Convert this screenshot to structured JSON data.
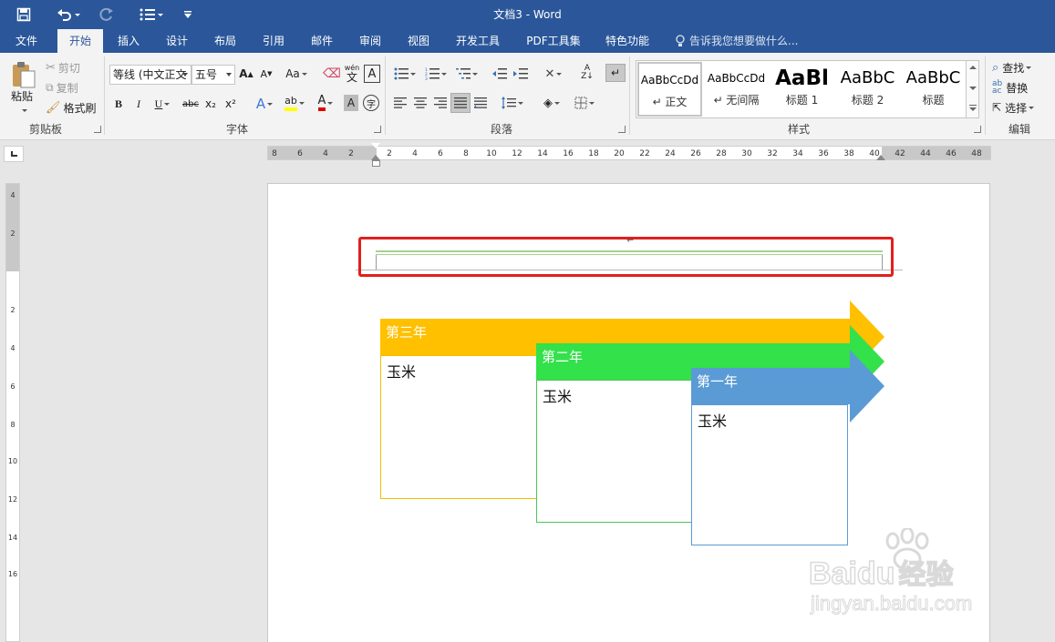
{
  "window": {
    "title": "文档3 - Word"
  },
  "tabs": [
    "文件",
    "开始",
    "插入",
    "设计",
    "布局",
    "引用",
    "邮件",
    "审阅",
    "视图",
    "开发工具",
    "PDF工具集",
    "特色功能"
  ],
  "tell_me": "告诉我您想要做什么...",
  "clipboard": {
    "paste": "粘贴",
    "cut": "剪切",
    "copy": "复制",
    "format_painter": "格式刷",
    "label": "剪贴板"
  },
  "font": {
    "name": "等线 (中文正文",
    "size": "五号",
    "label": "字体",
    "case_label": "Aa",
    "bold": "B",
    "italic": "I",
    "underline": "U",
    "strike": "abc",
    "subscript": "x₂",
    "superscript": "x²",
    "phonetic": "wén",
    "highlight_color": "#ffff00",
    "font_color": "#e00000"
  },
  "paragraph": {
    "label": "段落"
  },
  "styles": {
    "label": "样式",
    "items": [
      {
        "sample": "AaBbCcDd",
        "name": "↵ 正文"
      },
      {
        "sample": "AaBbCcDd",
        "name": "↵ 无间隔"
      },
      {
        "sample": "AaBl",
        "name": "标题 1"
      },
      {
        "sample": "AaBbC",
        "name": "标题 2"
      },
      {
        "sample": "AaBbC",
        "name": "标题"
      }
    ]
  },
  "editing": {
    "find": "查找",
    "replace": "替换",
    "select": "选择",
    "label": "编辑"
  },
  "hruler_ticks": [
    "8",
    "6",
    "4",
    "2",
    "2",
    "4",
    "6",
    "8",
    "10",
    "12",
    "14",
    "16",
    "18",
    "20",
    "22",
    "24",
    "26",
    "28",
    "30",
    "32",
    "34",
    "36",
    "38",
    "40",
    "42",
    "44",
    "46",
    "48"
  ],
  "vruler_ticks": [
    "4",
    "2",
    "2",
    "4",
    "6",
    "8",
    "10",
    "12",
    "14",
    "16"
  ],
  "document": {
    "paragraph_mark": "↵",
    "timeline": [
      {
        "label": "第三年",
        "content": "玉米",
        "color": "#ffc000",
        "border": "#f0c000"
      },
      {
        "label": "第二年",
        "content": "玉米",
        "color": "#33e14a",
        "border": "#4dc45a"
      },
      {
        "label": "第一年",
        "content": "玉米",
        "color": "#5b9bd5",
        "border": "#5b9bd5"
      }
    ]
  },
  "watermark": {
    "brand": "Baidu",
    "brand_cn": "经验",
    "url": "jingyan.baidu.com"
  },
  "colors": {
    "accent": "#2b579a",
    "highlight_border": "#e0201c",
    "header_line": "#a9d18e"
  }
}
